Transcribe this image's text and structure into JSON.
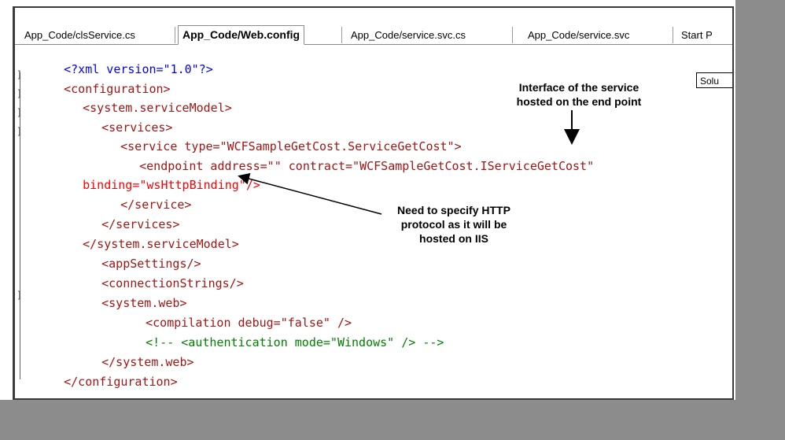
{
  "tabs": [
    {
      "label": "App_Code/clsService.cs",
      "active": false
    },
    {
      "label": "App_Code/Web.config",
      "active": true
    },
    {
      "label": "App_Code/service.svc.cs",
      "active": false
    },
    {
      "label": "App_Code/service.svc",
      "active": false
    },
    {
      "label": "Start P",
      "active": false
    }
  ],
  "side_panel_label": "Solu",
  "code_lines": [
    "<?xml version=\"1.0\"?>",
    "<configuration>",
    "<system.serviceModel>",
    "<services>",
    "<service type=\"WCFSampleGetCost.ServiceGetCost\">",
    "<endpoint address=\"\" contract=\"WCFSampleGetCost.IServiceGetCost\"",
    "binding=\"wsHttpBinding\"/>",
    "</service>",
    "</services>",
    "</system.serviceModel>",
    "<appSettings/>",
    "<connectionStrings/>",
    "<system.web>",
    "<compilation debug=\"false\" />",
    "<!-- <authentication mode=\"Windows\" /> -->",
    "</system.web>",
    "</configuration>"
  ],
  "annotations": {
    "interface_note": [
      "Interface of the service",
      "hosted on the end point"
    ],
    "binding_note": [
      "Need to specify HTTP",
      "protocol as it will be",
      "hosted on IIS"
    ]
  },
  "colors": {
    "tag": "#a31515",
    "attribute": "#ff0000",
    "value": "#0000ff",
    "comment": "#008000",
    "background_gray": "#8c8c8c"
  }
}
